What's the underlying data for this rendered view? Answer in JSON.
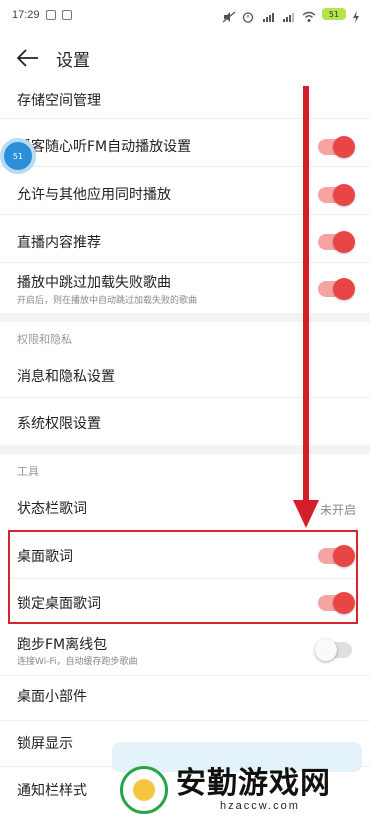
{
  "status_bar": {
    "time": "17:29",
    "battery": "51"
  },
  "header": {
    "title": "设置"
  },
  "rows": {
    "storage": {
      "label": "存储空间管理"
    },
    "fm_autoplay": {
      "label": "播客随心听FM自动播放设置",
      "toggle": "on"
    },
    "allow_others": {
      "label": "允许与其他应用同时播放",
      "toggle": "on"
    },
    "live_recommend": {
      "label": "直播内容推荐",
      "toggle": "on"
    },
    "skip_failed": {
      "label": "播放中跳过加载失败歌曲",
      "sub": "开启后，则在播放中自动跳过加载失败的歌曲",
      "toggle": "on"
    },
    "privacy_section": "权限和隐私",
    "msg_privacy": {
      "label": "消息和隐私设置"
    },
    "sys_perm": {
      "label": "系统权限设置"
    },
    "tools_section": "工具",
    "statusbar_lyrics": {
      "label": "状态栏歌词",
      "value": "未开启"
    },
    "desktop_lyrics": {
      "label": "桌面歌词",
      "toggle": "on"
    },
    "lock_desktop_lyrics": {
      "label": "锁定桌面歌词",
      "toggle": "on"
    },
    "run_fm": {
      "label": "跑步FM离线包",
      "sub": "连接Wi-Fi，自动缓存跑步歌曲",
      "toggle": "off"
    },
    "widget": {
      "label": "桌面小部件"
    },
    "lockscreen": {
      "label": "锁屏显示"
    },
    "notif_style": {
      "label": "通知栏样式"
    }
  },
  "float_ball": {
    "text": "51"
  },
  "watermark": {
    "title": "安勤游戏网",
    "url": "hzaccw.com"
  },
  "colors": {
    "accent": "#e84545",
    "arrow": "#d41f2a"
  }
}
